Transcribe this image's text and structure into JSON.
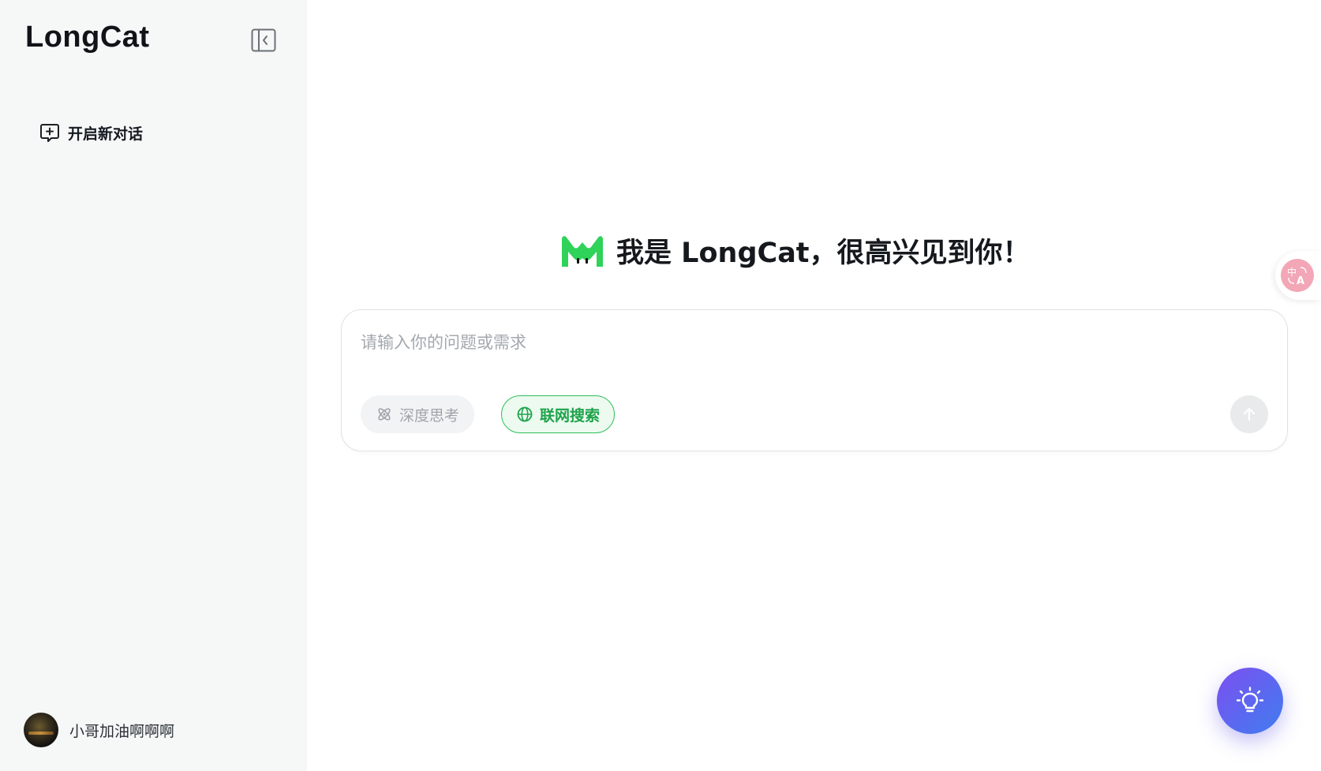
{
  "sidebar": {
    "brand": "LongCat",
    "new_chat_label": "开启新对话",
    "user_name": "小哥加油啊啊啊"
  },
  "main": {
    "greeting": "我是 LongCat，很高兴见到你！",
    "composer": {
      "placeholder": "请输入你的问题或需求",
      "deep_think_label": "深度思考",
      "web_search_label": "联网搜索"
    }
  },
  "colors": {
    "accent_green": "#2fbf5a",
    "sidebar_bg": "#f6f8f8",
    "fab_gradient_start": "#7d4ff0",
    "fab_gradient_end": "#3f7df0",
    "translate_pink": "#f2a6b6"
  },
  "icons": {
    "collapse": "sidebar-collapse-icon",
    "new_chat": "chat-plus-icon",
    "logo": "longcat-logo",
    "deep_think": "atom-icon",
    "web_search": "globe-icon",
    "send": "arrow-up-icon",
    "translate": "translate-icon",
    "idea": "lightbulb-icon"
  }
}
